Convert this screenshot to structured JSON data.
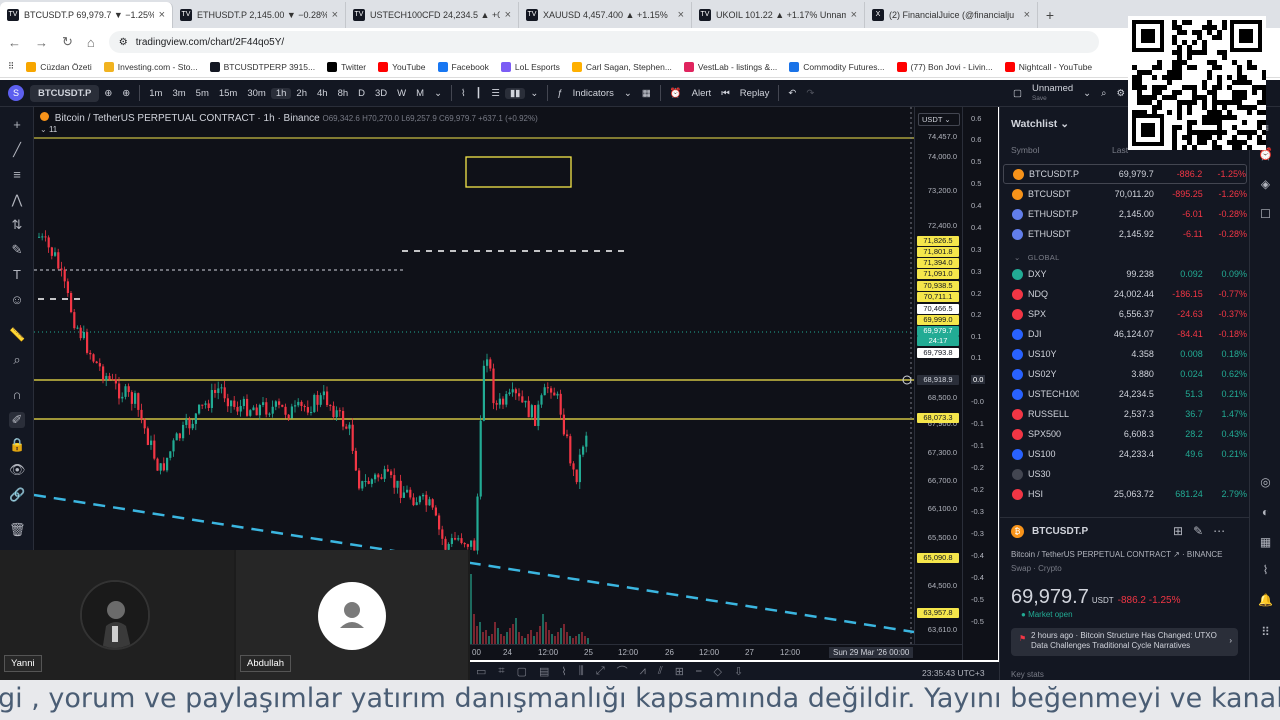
{
  "browser": {
    "tabs": [
      {
        "icon": "TV",
        "label": "BTCUSDT.P 69,979.7 ▼ −1.25%",
        "active": true
      },
      {
        "icon": "TV",
        "label": "ETHUSDT.P 2,145.00 ▼ −0.28%"
      },
      {
        "icon": "TV",
        "label": "USTECH100CFD 24,234.5 ▲ +0"
      },
      {
        "icon": "TV",
        "label": "XAUUSD 4,457.400 ▲ +1.15%"
      },
      {
        "icon": "TV",
        "label": "UKOIL 101.22 ▲ +1.17% Unnam"
      },
      {
        "icon": "X",
        "label": "(2) FinancialJuice (@financialju"
      }
    ],
    "new_tab": "+",
    "url": "tradingview.com/chart/2F44qo5Y/",
    "bookmarks": [
      {
        "label": "Cüzdan Özeti",
        "color": "#f7a600"
      },
      {
        "label": "Investing.com - Sto...",
        "color": "#f1b320"
      },
      {
        "label": "BTCUSDTPERP 3915...",
        "color": "#131722"
      },
      {
        "label": "Twitter",
        "color": "#000000"
      },
      {
        "label": "YouTube",
        "color": "#ff0000"
      },
      {
        "label": "Facebook",
        "color": "#1877f2"
      },
      {
        "label": "LoL Esports",
        "color": "#7b5cf5"
      },
      {
        "label": "Carl Sagan, Stephen...",
        "color": "#ffb000"
      },
      {
        "label": "VestLab - listings &...",
        "color": "#e0245e"
      },
      {
        "label": "Commodity Futures...",
        "color": "#1a73e8"
      },
      {
        "label": "(77) Bon Jovi - Livin...",
        "color": "#ff0000"
      },
      {
        "label": "Nightcall - YouTube",
        "color": "#ff0000"
      }
    ]
  },
  "toolbar": {
    "symbol": "BTCUSDT.P",
    "intervals": [
      "1m",
      "3m",
      "5m",
      "15m",
      "30m",
      "1h",
      "2h",
      "4h",
      "8h",
      "D",
      "3D",
      "W",
      "M"
    ],
    "active_interval": "1h",
    "indicators": "Indicators",
    "alert": "Alert",
    "replay": "Replay",
    "layout_name": "Unnamed",
    "layout_status": "Save"
  },
  "legend": {
    "title": "Bitcoin / TetherUS PERPETUAL CONTRACT · 1h · Binance",
    "ohlc": "O69,342.6  H70,270.0  L69,257.9  C69,979.7  +637.1 (+0.92%)",
    "count": "11"
  },
  "price_scale": {
    "currency": "USDT",
    "labels": [
      {
        "v": "74,457.0",
        "t": 137
      },
      {
        "v": "74,000.0",
        "t": 157
      },
      {
        "v": "73,200.0",
        "t": 191
      },
      {
        "v": "72,400.0",
        "t": 226
      },
      {
        "v": "68,500.0",
        "t": 398
      },
      {
        "v": "67,900.0",
        "t": 424
      },
      {
        "v": "67,300.0",
        "t": 453
      },
      {
        "v": "66,700.0",
        "t": 481
      },
      {
        "v": "66,100.0",
        "t": 509
      },
      {
        "v": "65,500.0",
        "t": 538
      },
      {
        "v": "64,500.0",
        "t": 586
      },
      {
        "v": "63,610.0",
        "t": 630
      }
    ],
    "badges": [
      {
        "v": "71,826.5",
        "t": 241,
        "bg": "#f5e64b",
        "fg": "#131722"
      },
      {
        "v": "71,801.8",
        "t": 252,
        "bg": "#f5e64b",
        "fg": "#131722"
      },
      {
        "v": "71,394.0",
        "t": 263,
        "bg": "#f5e64b",
        "fg": "#131722"
      },
      {
        "v": "71,091.0",
        "t": 274,
        "bg": "#f5e64b",
        "fg": "#131722"
      },
      {
        "v": "70,938.5",
        "t": 286,
        "bg": "#f5e64b",
        "fg": "#131722"
      },
      {
        "v": "70,711.1",
        "t": 297,
        "bg": "#f5e64b",
        "fg": "#131722"
      },
      {
        "v": "70,466.5",
        "t": 309,
        "bg": "#ffffff",
        "fg": "#131722"
      },
      {
        "v": "69,999.0",
        "t": 320,
        "bg": "#f5e64b",
        "fg": "#131722"
      },
      {
        "v": "69,979.7",
        "t": 331,
        "bg": "#22ab94",
        "fg": "#ffffff"
      },
      {
        "v": "24:17",
        "t": 341,
        "bg": "#22ab94",
        "fg": "#ffffff"
      },
      {
        "v": "69,793.8",
        "t": 353,
        "bg": "#ffffff",
        "fg": "#131722"
      },
      {
        "v": "68,918.9",
        "t": 380,
        "bg": "#2a2e39",
        "fg": "#d1d4dc"
      },
      {
        "v": "68,073.3",
        "t": 418,
        "bg": "#f5e64b",
        "fg": "#131722"
      },
      {
        "v": "65,090.8",
        "t": 558,
        "bg": "#f5e64b",
        "fg": "#131722"
      },
      {
        "v": "63,957.8",
        "t": 613,
        "bg": "#f5e64b",
        "fg": "#131722"
      }
    ]
  },
  "osc_scale": [
    {
      "v": "0.6",
      "t": 119
    },
    {
      "v": "0.6",
      "t": 140
    },
    {
      "v": "0.5",
      "t": 162
    },
    {
      "v": "0.5",
      "t": 184
    },
    {
      "v": "0.4",
      "t": 206
    },
    {
      "v": "0.4",
      "t": 228
    },
    {
      "v": "0.3",
      "t": 250
    },
    {
      "v": "0.3",
      "t": 272
    },
    {
      "v": "0.2",
      "t": 294
    },
    {
      "v": "0.2",
      "t": 315
    },
    {
      "v": "0.1",
      "t": 337
    },
    {
      "v": "0.1",
      "t": 358
    },
    {
      "v": "0.0",
      "t": 380
    },
    {
      "v": "-0.0",
      "t": 402
    },
    {
      "v": "-0.1",
      "t": 424
    },
    {
      "v": "-0.1",
      "t": 446
    },
    {
      "v": "-0.2",
      "t": 468
    },
    {
      "v": "-0.2",
      "t": 490
    },
    {
      "v": "-0.3",
      "t": 512
    },
    {
      "v": "-0.3",
      "t": 534
    },
    {
      "v": "-0.4",
      "t": 556
    },
    {
      "v": "-0.4",
      "t": 578
    },
    {
      "v": "-0.5",
      "t": 600
    },
    {
      "v": "-0.5",
      "t": 622
    }
  ],
  "time_axis": {
    "labels": [
      {
        "v": "00",
        "l": 438
      },
      {
        "v": "24",
        "l": 469
      },
      {
        "v": "12:00",
        "l": 504
      },
      {
        "v": "25",
        "l": 550
      },
      {
        "v": "12:00",
        "l": 584
      },
      {
        "v": "26",
        "l": 631
      },
      {
        "v": "12:00",
        "l": 665
      },
      {
        "v": "27",
        "l": 711
      },
      {
        "v": "12:00",
        "l": 746
      }
    ],
    "date_badge": "Sun 29 Mar '26",
    "date_badge_time": "00:00",
    "clock": "23:35:43 UTC+3"
  },
  "cams": {
    "user1": "Yanni",
    "user2": "Abdullah"
  },
  "watchlist": {
    "title": "Watchlist",
    "columns": [
      "Symbol",
      "Last",
      "Chg",
      "Chg%"
    ],
    "section": "GLOBAL",
    "rows": [
      {
        "icon": "#f7931a",
        "sym": "BTCUSDT.P",
        "last": "69,979.7",
        "chg": "-886.2",
        "pct": "-1.25%",
        "dir": "red",
        "sel": true
      },
      {
        "icon": "#f7931a",
        "sym": "BTCUSDT",
        "last": "70,011.20",
        "chg": "-895.25",
        "pct": "-1.26%",
        "dir": "red"
      },
      {
        "icon": "#627eea",
        "sym": "ETHUSDT.P",
        "last": "2,145.00",
        "chg": "-6.01",
        "pct": "-0.28%",
        "dir": "red"
      },
      {
        "icon": "#627eea",
        "sym": "ETHUSDT",
        "last": "2,145.92",
        "chg": "-6.11",
        "pct": "-0.28%",
        "dir": "red"
      },
      {
        "section": true
      },
      {
        "icon": "#22ab94",
        "sym": "DXY",
        "last": "99.238",
        "chg": "0.092",
        "pct": "0.09%",
        "dir": "grn"
      },
      {
        "icon": "#f23645",
        "sym": "NDQ",
        "last": "24,002.44",
        "chg": "-186.15",
        "pct": "-0.77%",
        "dir": "red"
      },
      {
        "icon": "#f23645",
        "sym": "SPX",
        "last": "6,556.37",
        "chg": "-24.63",
        "pct": "-0.37%",
        "dir": "red"
      },
      {
        "icon": "#2962ff",
        "sym": "DJI",
        "last": "46,124.07",
        "chg": "-84.41",
        "pct": "-0.18%",
        "dir": "red"
      },
      {
        "icon": "#2962ff",
        "sym": "US10Y",
        "last": "4.358",
        "chg": "0.008",
        "pct": "0.18%",
        "dir": "grn"
      },
      {
        "icon": "#2962ff",
        "sym": "US02Y",
        "last": "3.880",
        "chg": "0.024",
        "pct": "0.62%",
        "dir": "grn"
      },
      {
        "icon": "#2962ff",
        "sym": "USTECH100",
        "last": "24,234.5",
        "chg": "51.3",
        "pct": "0.21%",
        "dir": "grn"
      },
      {
        "icon": "#f23645",
        "sym": "RUSSELL",
        "last": "2,537.3",
        "chg": "36.7",
        "pct": "1.47%",
        "dir": "grn"
      },
      {
        "icon": "#f23645",
        "sym": "SPX500",
        "last": "6,608.3",
        "chg": "28.2",
        "pct": "0.43%",
        "dir": "grn"
      },
      {
        "icon": "#2962ff",
        "sym": "US100",
        "last": "24,233.4",
        "chg": "49.6",
        "pct": "0.21%",
        "dir": "grn"
      },
      {
        "icon": "#434651",
        "sym": "US30",
        "last": "",
        "chg": "",
        "pct": "",
        "dir": "red"
      },
      {
        "icon": "#f23645",
        "sym": "HSI",
        "last": "25,063.72",
        "chg": "681.24",
        "pct": "2.79%",
        "dir": "grn"
      }
    ]
  },
  "detail": {
    "symbol": "BTCUSDT.P",
    "description": "Bitcoin / TetherUS PERPETUAL CONTRACT ↗ · BINANCE",
    "sub": "Swap · Crypto",
    "price": "69,979.7",
    "unit": "USDT",
    "change": "-886.2 -1.25%",
    "status": "Market open",
    "news": "2 hours ago · Bitcoin Structure Has Changed: UTXO Data Challenges Traditional Cycle Narratives",
    "key_stats": "Key stats"
  },
  "ticker": "gi , yorum ve paylaşımlar yatırım danışmanlığı kapsamında değildir. Yayını beğenmeyi ve kanalımızı takip etm",
  "colors": {
    "bg": "#0f1118",
    "panel": "#131722",
    "up": "#22ab94",
    "down": "#f23645",
    "level": "#f5e64b",
    "trend": "#3bb6e0"
  }
}
